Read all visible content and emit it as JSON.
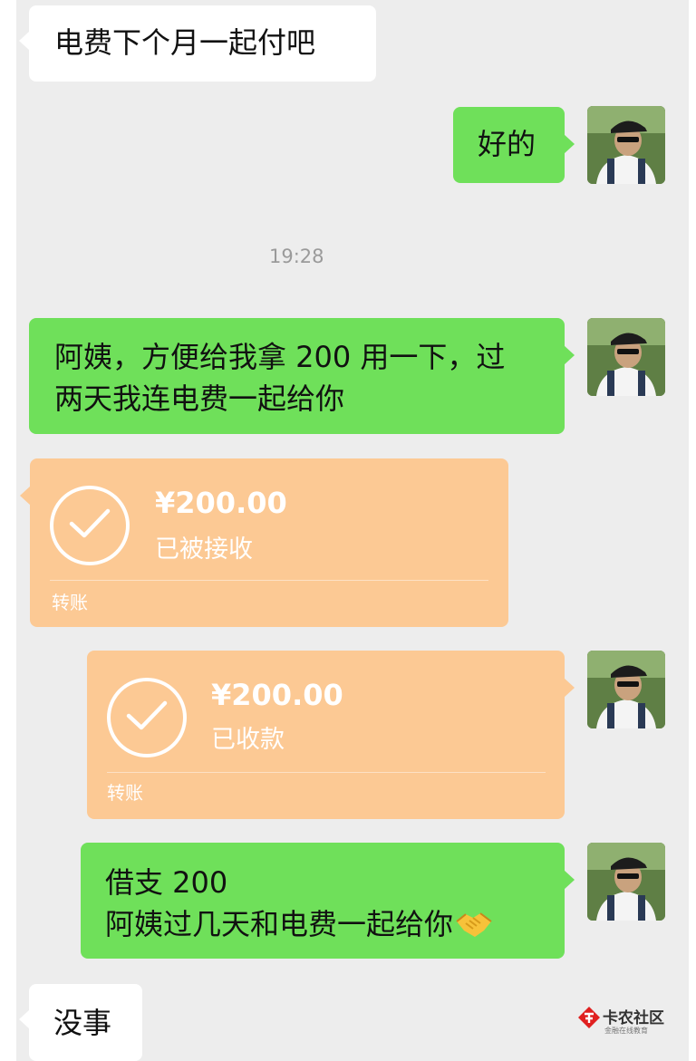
{
  "messages": {
    "m1": "电费下个月一起付吧",
    "m2": "好的",
    "time": "19:28",
    "m3_line1": "阿姨，方便给我拿 200 用一下，过",
    "m3_line2": "两天我连电费一起给你",
    "m6_line1": "借支 200",
    "m6_line2": "阿姨过几天和电费一起给你",
    "m7": "没事"
  },
  "transfers": {
    "received": {
      "amount": "¥200.00",
      "status": "已被接收",
      "kind": "转账"
    },
    "collected": {
      "amount": "¥200.00",
      "status": "已收款",
      "kind": "转账"
    }
  },
  "watermark": {
    "name": "卡农社区",
    "tagline": "金融在线教育"
  },
  "icons": {
    "handshake": "handshake-emoji-icon",
    "check": "check-circle-icon",
    "logo": "kanong-logo-icon"
  },
  "colors": {
    "chat_bg": "#ededed",
    "self_bubble": "#6fe05a",
    "other_bubble": "#ffffff",
    "transfer": "#fcc994"
  }
}
